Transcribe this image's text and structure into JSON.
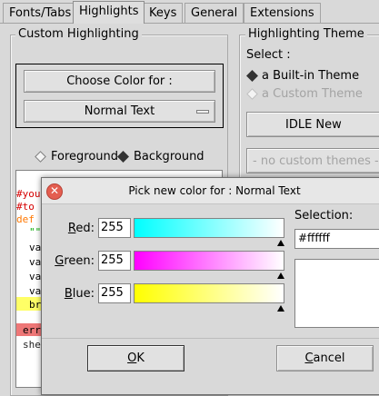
{
  "tabs": [
    "Fonts/Tabs",
    "Highlights",
    "Keys",
    "General",
    "Extensions"
  ],
  "custom_highlighting": {
    "label": "Custom Highlighting",
    "choose_color_label": "Choose Color for :",
    "element_dropdown": "Normal Text",
    "foreground_label": "Foreground",
    "background_label": "Background",
    "selected_target": "Background",
    "code_fragments": [
      "#you",
      "#to",
      "def",
      "\"\"",
      "va",
      "va",
      "va",
      "va",
      "br",
      "err",
      "she"
    ]
  },
  "highlighting_theme": {
    "label": "Highlighting Theme",
    "select_label": "Select :",
    "builtin_label": "a Built-in Theme",
    "custom_label": "a Custom Theme",
    "builtin_theme": "IDLE New",
    "custom_theme": "- no custom themes -"
  },
  "dialog": {
    "title": "Pick new color for : Normal Text",
    "red_label": "Red:",
    "green_label": "Green:",
    "blue_label": "Blue:",
    "red_value": "255",
    "green_value": "255",
    "blue_value": "255",
    "selection_label": "Selection:",
    "selection_value": "#ffffff",
    "selected_color": "#ffffff",
    "ok_label": "OK",
    "cancel_label": "Cancel"
  },
  "icons": {
    "close": "close-icon",
    "dropdown": "menubutton-indicator-icon"
  }
}
